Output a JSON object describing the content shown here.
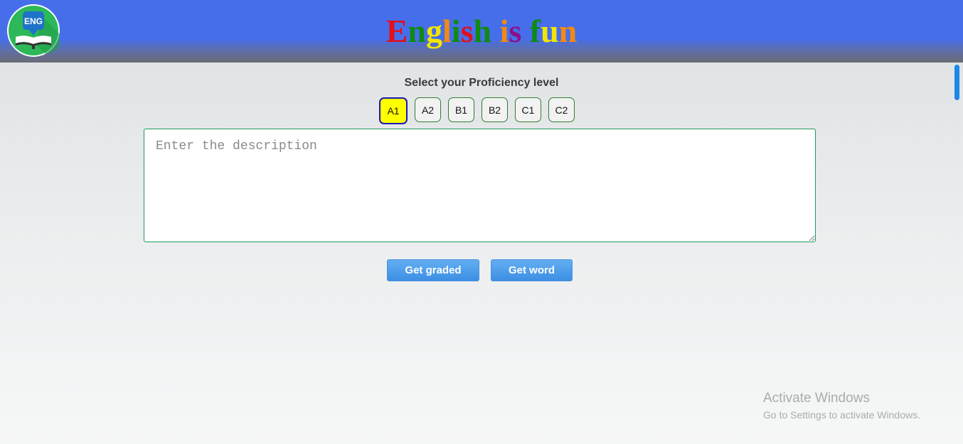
{
  "header": {
    "logo_text": "ENG",
    "title_letters": [
      {
        "char": "E",
        "color": "#e0101c"
      },
      {
        "char": "n",
        "color": "#108a10"
      },
      {
        "char": "g",
        "color": "#f2e600"
      },
      {
        "char": "l",
        "color": "#f28a10"
      },
      {
        "char": "i",
        "color": "#108a10"
      },
      {
        "char": "s",
        "color": "#e0101c"
      },
      {
        "char": "h",
        "color": "#108a10"
      },
      {
        "char": " ",
        "color": "#000000"
      },
      {
        "char": "i",
        "color": "#f28a10"
      },
      {
        "char": "s",
        "color": "#8a108a"
      },
      {
        "char": " ",
        "color": "#000000"
      },
      {
        "char": "f",
        "color": "#108a10"
      },
      {
        "char": "u",
        "color": "#f2e600"
      },
      {
        "char": "n",
        "color": "#f28a10"
      }
    ],
    "background_color": "#466eeb"
  },
  "proficiency": {
    "label": "Select your Proficiency level",
    "levels": [
      "A1",
      "A2",
      "B1",
      "B2",
      "C1",
      "C2"
    ],
    "selected": "A1",
    "selected_color": "#ffff00"
  },
  "description": {
    "placeholder": "Enter the description",
    "value": ""
  },
  "actions": {
    "graded_label": "Get graded",
    "word_label": "Get word",
    "button_color": "#3d8fe3"
  },
  "watermark": {
    "title": "Activate Windows",
    "subtitle": "Go to Settings to activate Windows."
  }
}
